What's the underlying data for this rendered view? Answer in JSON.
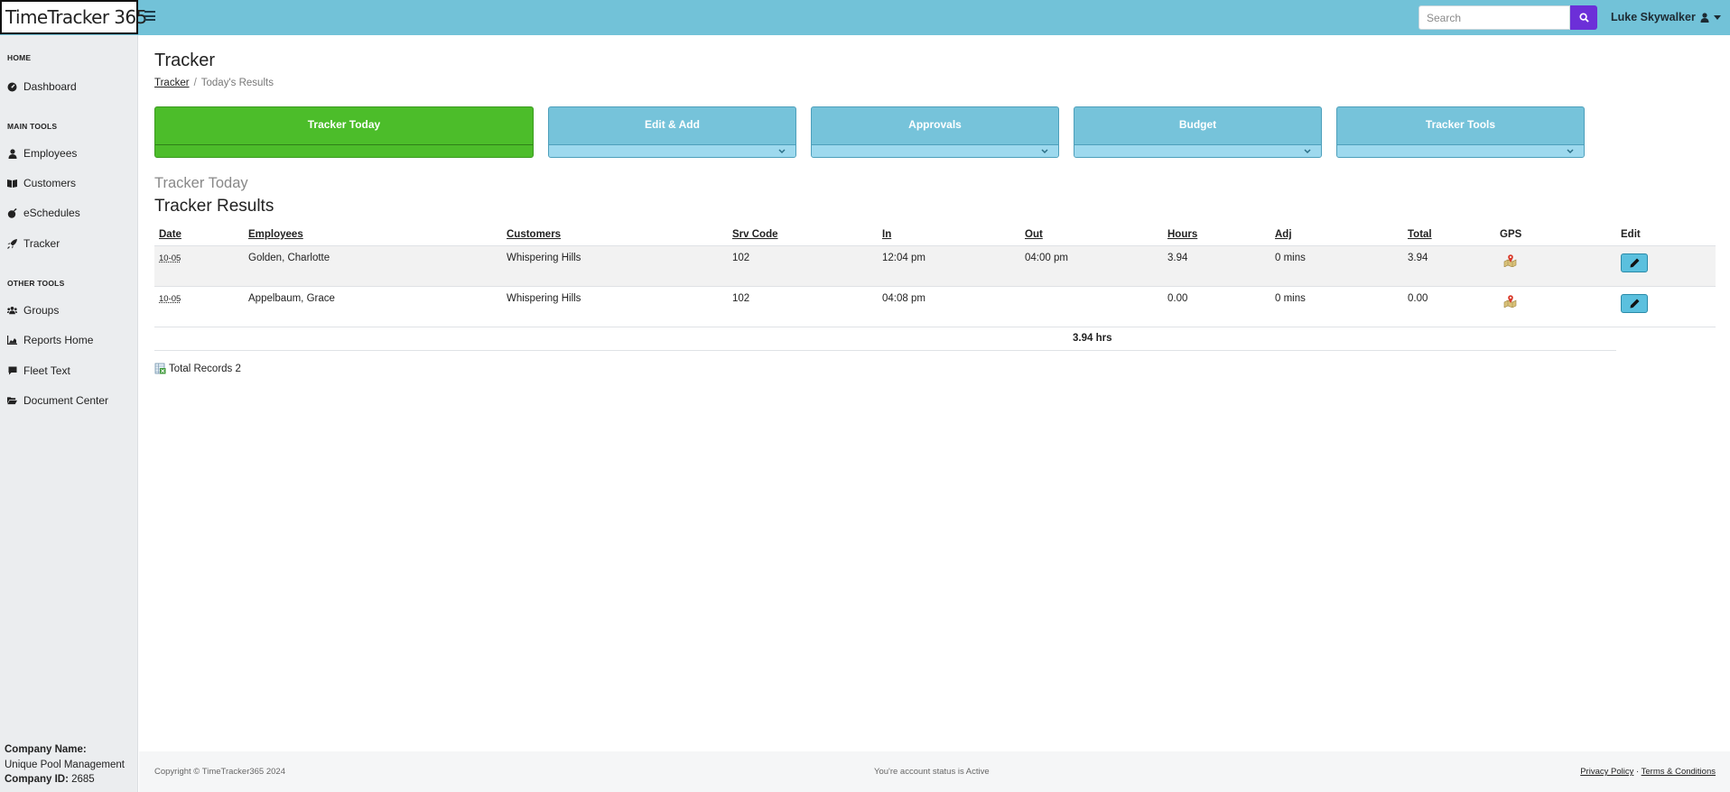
{
  "app": {
    "logo_text": "TimeTracker 365",
    "search_placeholder": "Search",
    "user_name": "Luke Skywalker"
  },
  "sidebar": {
    "sections": {
      "home": "HOME",
      "main_tools": "MAIN TOOLS",
      "other_tools": "OTHER TOOLS"
    },
    "items": [
      {
        "label": "Dashboard",
        "icon": "dashboard-icon"
      },
      {
        "label": "Employees",
        "icon": "user-icon"
      },
      {
        "label": "Customers",
        "icon": "book-icon"
      },
      {
        "label": "eSchedules",
        "icon": "bomb-icon"
      },
      {
        "label": "Tracker",
        "icon": "rocket-icon"
      },
      {
        "label": "Groups",
        "icon": "users-icon"
      },
      {
        "label": "Reports Home",
        "icon": "chart-area-icon"
      },
      {
        "label": "Fleet Text",
        "icon": "comment-icon"
      },
      {
        "label": "Document Center",
        "icon": "folder-open-icon"
      }
    ],
    "company": {
      "name_label": "Company Name:",
      "name": "Unique Pool Management",
      "id_label": "Company ID:",
      "id": "2685"
    }
  },
  "page": {
    "title": "Tracker",
    "breadcrumb": {
      "link": "Tracker",
      "current": "Today's Results"
    },
    "tiles": [
      {
        "label": "Tracker Today",
        "active": true
      },
      {
        "label": "Edit & Add",
        "active": false
      },
      {
        "label": "Approvals",
        "active": false
      },
      {
        "label": "Budget",
        "active": false
      },
      {
        "label": "Tracker Tools",
        "active": false
      }
    ],
    "subtitle": "Tracker Today",
    "results_title": "Tracker Results"
  },
  "table": {
    "columns": [
      "Date",
      "Employees",
      "Customers",
      "Srv Code",
      "In",
      "Out",
      "Hours",
      "Adj",
      "Total",
      "GPS",
      "Edit"
    ],
    "rows": [
      {
        "date": "10-05",
        "employee": "Golden, Charlotte",
        "customer": "Whispering Hills",
        "srv_code": "102",
        "in": "12:04 pm",
        "out": "04:00 pm",
        "hours": "3.94",
        "adj": "0 mins",
        "total": "3.94"
      },
      {
        "date": "10-05",
        "employee": "Appelbaum, Grace",
        "customer": "Whispering Hills",
        "srv_code": "102",
        "in": "04:08 pm",
        "out": "",
        "hours": "0.00",
        "adj": "0 mins",
        "total": "0.00"
      }
    ],
    "total_hours": "3.94 hrs",
    "total_records": "Total Records 2"
  },
  "footer": {
    "copyright": "Copyright © TimeTracker365 2024",
    "status": "You're account status is Active",
    "privacy": "Privacy Policy",
    "separator": "·",
    "terms": "Terms & Conditions"
  },
  "colors": {
    "topbar": "#72c2d8",
    "tile": "#76c3da",
    "tile_active": "#4cbd2a",
    "search_button": "#6c2fd8",
    "edit_button": "#5bc0de"
  }
}
